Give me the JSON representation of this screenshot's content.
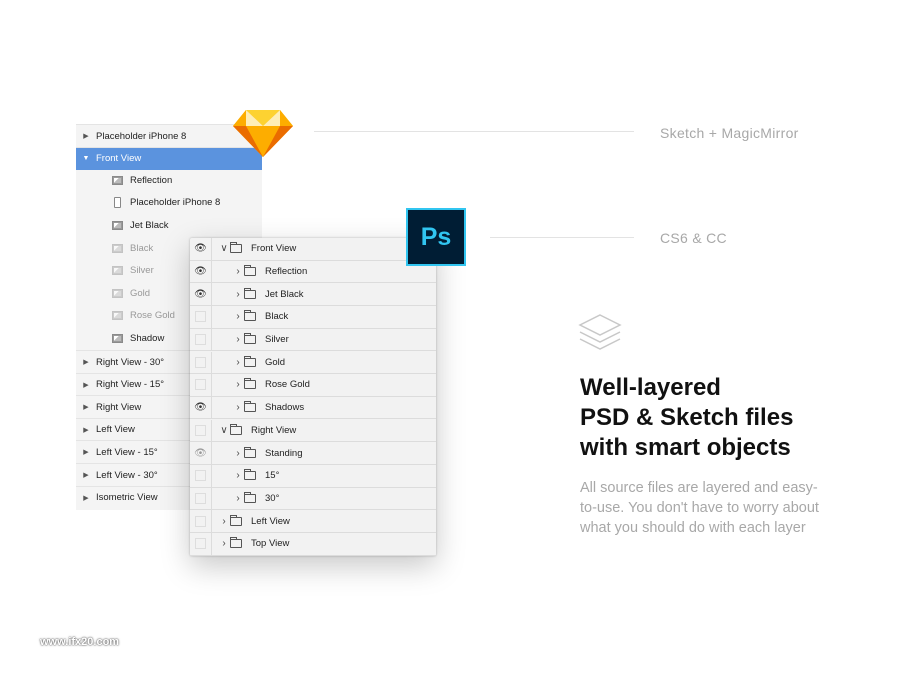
{
  "sketch_panel": {
    "rows": [
      {
        "label": "Placeholder iPhone 8",
        "type": "group",
        "arrow": "▶"
      },
      {
        "label": "Front View",
        "type": "group-open",
        "arrow": "▼"
      },
      {
        "label": "Reflection",
        "type": "image"
      },
      {
        "label": "Placeholder iPhone 8",
        "type": "phone"
      },
      {
        "label": "Jet Black",
        "type": "image"
      },
      {
        "label": "Black",
        "type": "image-dim"
      },
      {
        "label": "Silver",
        "type": "image-dim"
      },
      {
        "label": "Gold",
        "type": "image-dim"
      },
      {
        "label": "Rose Gold",
        "type": "image-dim"
      },
      {
        "label": "Shadow",
        "type": "image"
      },
      {
        "label": "Right View - 30°",
        "type": "group",
        "arrow": "▶"
      },
      {
        "label": "Right View - 15°",
        "type": "group",
        "arrow": "▶"
      },
      {
        "label": "Right View",
        "type": "group",
        "arrow": "▶"
      },
      {
        "label": "Left View",
        "type": "group",
        "arrow": "▶"
      },
      {
        "label": "Left View - 15°",
        "type": "group",
        "arrow": "▶"
      },
      {
        "label": "Left View - 30°",
        "type": "group",
        "arrow": "▶"
      },
      {
        "label": "Isometric View",
        "type": "group",
        "arrow": "▶"
      }
    ]
  },
  "ps_logo": {
    "label": "Ps"
  },
  "ps_panel": {
    "rows": [
      {
        "label": "Front View",
        "vis": "eye",
        "level": 0,
        "chev": "∨"
      },
      {
        "label": "Reflection",
        "vis": "eye",
        "level": 1,
        "chev": "›"
      },
      {
        "label": "Jet Black",
        "vis": "eye",
        "level": 1,
        "chev": "›"
      },
      {
        "label": "Black",
        "vis": "box",
        "level": 1,
        "chev": "›"
      },
      {
        "label": "Silver",
        "vis": "box",
        "level": 1,
        "chev": "›"
      },
      {
        "label": "Gold",
        "vis": "box",
        "level": 1,
        "chev": "›"
      },
      {
        "label": "Rose Gold",
        "vis": "box",
        "level": 1,
        "chev": "›"
      },
      {
        "label": "Shadows",
        "vis": "eye",
        "level": 1,
        "chev": "›"
      },
      {
        "label": "Right View",
        "vis": "box",
        "level": 0,
        "chev": "∨"
      },
      {
        "label": "Standing",
        "vis": "eye-dim",
        "level": 1,
        "chev": "›"
      },
      {
        "label": "15°",
        "vis": "box",
        "level": 1,
        "chev": "›"
      },
      {
        "label": "30°",
        "vis": "box",
        "level": 1,
        "chev": "›"
      },
      {
        "label": "Left View",
        "vis": "box",
        "level": 0,
        "chev": "›"
      },
      {
        "label": "Top View",
        "vis": "box",
        "level": 0,
        "chev": "›"
      }
    ]
  },
  "labels": {
    "sketch": "Sketch + MagicMirror",
    "ps": "CS6 & CC"
  },
  "headline": [
    "Well-layered",
    "PSD & Sketch files",
    "with smart objects"
  ],
  "description": "All source files are layered and easy-to-use. You don't have to worry about what you should do with each layer",
  "watermark": "www.ifx20.com",
  "icons": {
    "eye": "👁",
    "layers": "layers-icon",
    "sketch": "sketch-diamond-icon"
  },
  "colors": {
    "selection": "#5b93de",
    "ps_bg": "#001d34",
    "ps_blue": "#31c5f0",
    "sketch_orange": "#f7b500"
  }
}
